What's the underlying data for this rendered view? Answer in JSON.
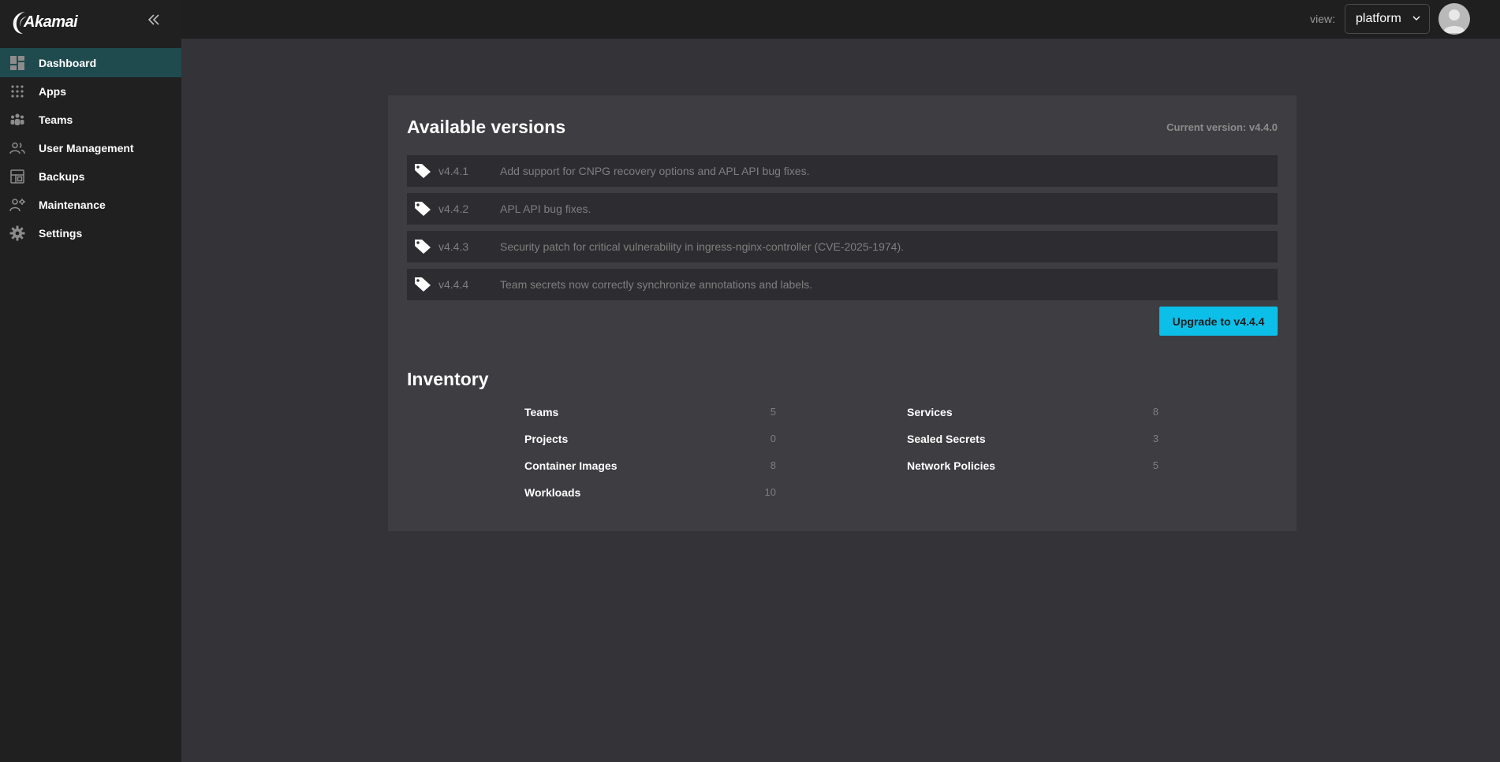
{
  "brand": {
    "logo_text": "Akamai"
  },
  "sidebar": {
    "items": [
      {
        "label": "Dashboard",
        "icon": "dashboard-icon",
        "active": true
      },
      {
        "label": "Apps",
        "icon": "apps-grid-icon"
      },
      {
        "label": "Teams",
        "icon": "teams-icon"
      },
      {
        "label": "User Management",
        "icon": "user-management-icon"
      },
      {
        "label": "Backups",
        "icon": "backups-icon"
      },
      {
        "label": "Maintenance",
        "icon": "maintenance-icon"
      },
      {
        "label": "Settings",
        "icon": "gear-icon"
      }
    ]
  },
  "header": {
    "view_label": "view:",
    "view_value": "platform"
  },
  "versions": {
    "title": "Available versions",
    "current_version": "Current version: v4.4.0",
    "items": [
      {
        "version": "v4.4.1",
        "description": "Add support for CNPG recovery options and APL API bug fixes."
      },
      {
        "version": "v4.4.2",
        "description": "APL API bug fixes."
      },
      {
        "version": "v4.4.3",
        "description": "Security patch for critical vulnerability in ingress-nginx-controller (CVE-2025-1974)."
      },
      {
        "version": "v4.4.4",
        "description": "Team secrets now correctly synchronize annotations and labels."
      }
    ],
    "upgrade_label": "Upgrade to v4.4.4"
  },
  "inventory": {
    "title": "Inventory",
    "left": [
      {
        "label": "Teams",
        "count": "5"
      },
      {
        "label": "Projects",
        "count": "0"
      },
      {
        "label": "Container Images",
        "count": "8"
      },
      {
        "label": "Workloads",
        "count": "10"
      }
    ],
    "right": [
      {
        "label": "Services",
        "count": "8"
      },
      {
        "label": "Sealed Secrets",
        "count": "3"
      },
      {
        "label": "Network Policies",
        "count": "5"
      }
    ]
  },
  "colors": {
    "accent": "#0bbfe8",
    "sidebar_active": "#1f4b4f",
    "background": "#333338"
  }
}
